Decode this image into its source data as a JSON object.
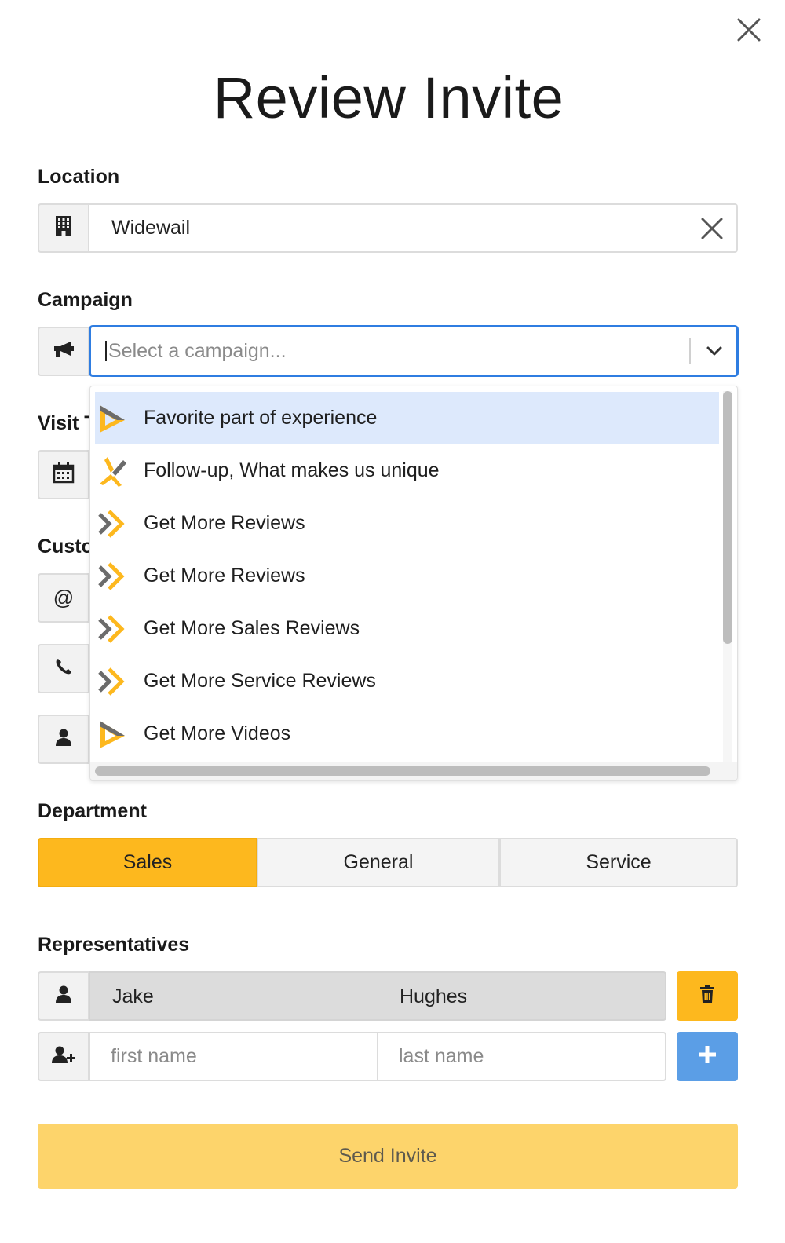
{
  "modal": {
    "title": "Review Invite"
  },
  "location": {
    "label": "Location",
    "value": "Widewail"
  },
  "campaign": {
    "label": "Campaign",
    "placeholder": "Select a campaign...",
    "options": [
      {
        "label": "Favorite part of experience",
        "icon": "play-logo-icon",
        "highlighted": true
      },
      {
        "label": "Follow-up, What makes us unique",
        "icon": "star-logo-icon",
        "highlighted": false
      },
      {
        "label": "Get More Reviews",
        "icon": "chevrons-logo-icon",
        "highlighted": false
      },
      {
        "label": "Get More Reviews",
        "icon": "chevrons-logo-icon",
        "highlighted": false
      },
      {
        "label": "Get More Sales Reviews",
        "icon": "chevrons-logo-icon",
        "highlighted": false
      },
      {
        "label": "Get More Service Reviews",
        "icon": "chevrons-logo-icon",
        "highlighted": false
      },
      {
        "label": "Get More Videos",
        "icon": "play-logo-icon",
        "highlighted": false
      }
    ]
  },
  "hidden_labels": {
    "visit": "Visit T",
    "customer": "Custo"
  },
  "department": {
    "label": "Department",
    "options": [
      "Sales",
      "General",
      "Service"
    ],
    "selected": "Sales"
  },
  "representatives": {
    "label": "Representatives",
    "entries": [
      {
        "first": "Jake",
        "last": "Hughes"
      }
    ],
    "new_first_placeholder": "first name",
    "new_last_placeholder": "last name"
  },
  "actions": {
    "send_label": "Send Invite"
  },
  "colors": {
    "accent_yellow": "#fdb81e",
    "focus_blue": "#2f7de1",
    "add_blue": "#5b9ee6",
    "send_disabled": "#fdd46b",
    "logo_gray": "#6b6b6b"
  }
}
